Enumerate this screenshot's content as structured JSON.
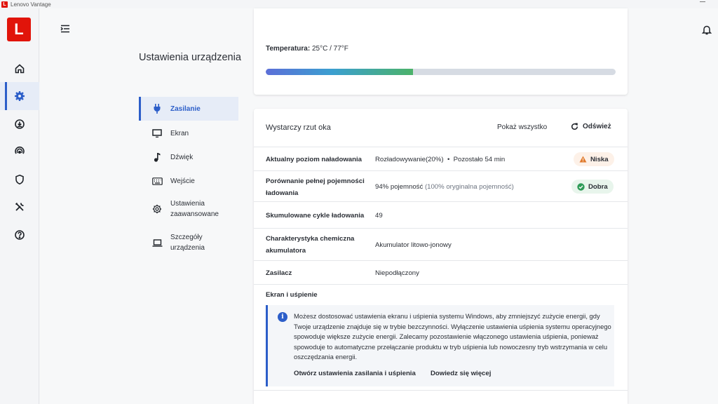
{
  "window": {
    "title": "Lenovo Vantage",
    "app_icon_letter": "L"
  },
  "rail": {
    "logo_letter": "L",
    "items": [
      {
        "name": "home",
        "icon": "home-icon",
        "active": false
      },
      {
        "name": "device-settings",
        "icon": "gear-icon",
        "active": true
      },
      {
        "name": "updates",
        "icon": "download-icon",
        "active": false
      },
      {
        "name": "performance",
        "icon": "gauge-icon",
        "active": false
      },
      {
        "name": "security",
        "icon": "shield-icon",
        "active": false
      },
      {
        "name": "tools",
        "icon": "tools-icon",
        "active": false
      },
      {
        "name": "help",
        "icon": "help-icon",
        "active": false
      }
    ]
  },
  "section": {
    "title": "Ustawienia urządzenia"
  },
  "subnav": {
    "power": "Zasilanie",
    "display": "Ekran",
    "sound": "Dźwięk",
    "input": "Wejście",
    "advanced": "Ustawienia zaawansowane",
    "device_details": "Szczegóły urządzenia"
  },
  "battery": {
    "temperature_label": "Temperatura:",
    "temperature_value": "25°C / 77°F",
    "level_fraction": 0.42
  },
  "glance": {
    "title": "Wystarczy rzut oka",
    "show_all": "Pokaż wszystko",
    "refresh": "Odśwież",
    "rows": {
      "charge_level": {
        "label": "Aktualny poziom naładowania",
        "value": "Rozładowywanie(20%)",
        "separator": "•",
        "remaining": "Pozostało 54 min",
        "badge": "Niska"
      },
      "capacity": {
        "label": "Porównanie pełnej pojemności ładowania",
        "value": "94% pojemność",
        "detail": "(100% oryginalna pojemność)",
        "badge": "Dobra"
      },
      "cycles": {
        "label": "Skumulowane cykle ładowania",
        "value": "49"
      },
      "chemistry": {
        "label": "Charakterystyka chemiczna akumulatora",
        "value": "Akumulator litowo-jonowy"
      },
      "adapter": {
        "label": "Zasilacz",
        "value": "Niepodłączony"
      }
    }
  },
  "sleep": {
    "title": "Ekran i uśpienie",
    "info": "Możesz dostosować ustawienia ekranu i uśpienia systemu Windows, aby zmniejszyć zużycie energii, gdy Twoje urządzenie znajduje się w trybie bezczynności. Wyłączenie ustawienia uśpienia systemu operacyjnego spowoduje większe zużycie energii. Zalecamy pozostawienie włączonego ustawienia uśpienia, ponieważ spowoduje to automatyczne przełączanie produktu w tryb uśpienia lub nowoczesny tryb wstrzymania w celu oszczędzania energii.",
    "link_open": "Otwórz ustawienia zasilania i uśpienia",
    "link_more": "Dowiedz się więcej"
  },
  "colors": {
    "accent": "#2c5ec9",
    "brand": "#e1140a",
    "warning": "#e07a2c",
    "success": "#2e9b57"
  }
}
